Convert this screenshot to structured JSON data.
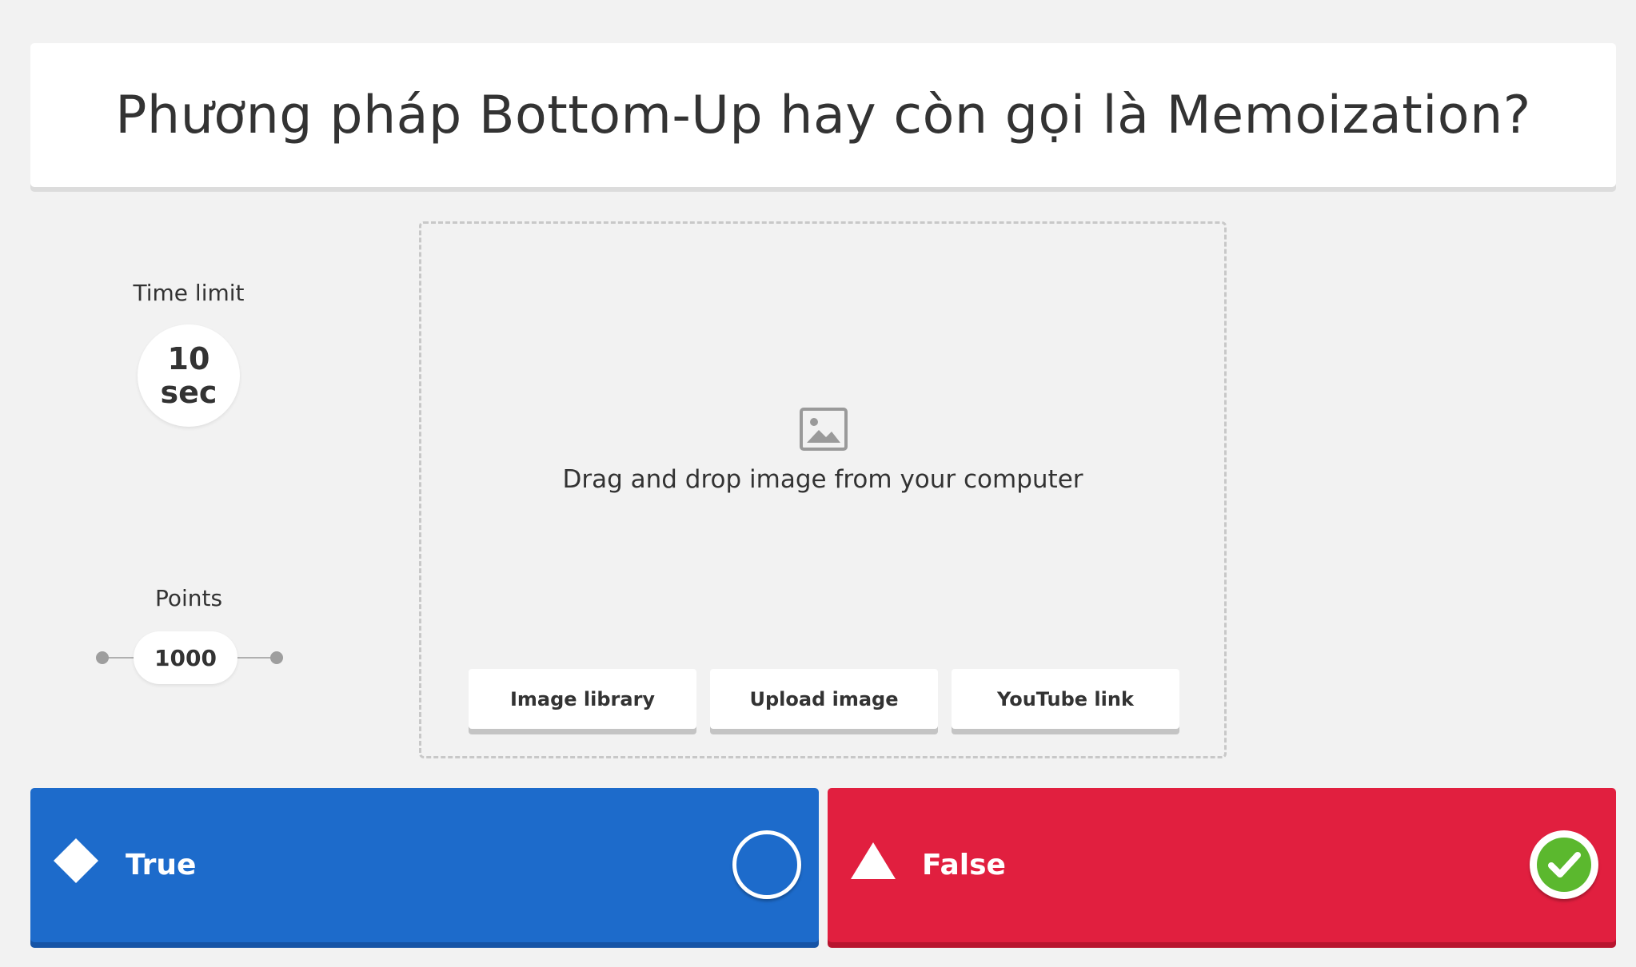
{
  "question": {
    "text": "Phương pháp Bottom-Up hay còn gọi là Memoization?"
  },
  "settings": {
    "time_limit_label": "Time limit",
    "time_value": "10",
    "time_unit": "sec",
    "points_label": "Points",
    "points_value": "1000"
  },
  "media": {
    "icon": "image-icon",
    "drop_text": "Drag and drop image from your computer",
    "buttons": [
      {
        "label": "Image library"
      },
      {
        "label": "Upload image"
      },
      {
        "label": "YouTube link"
      }
    ]
  },
  "answers": [
    {
      "label": "True",
      "shape": "diamond-icon",
      "color": "#1d6bcb",
      "correct": false
    },
    {
      "label": "False",
      "shape": "triangle-icon",
      "color": "#e11f3f",
      "correct": true
    }
  ],
  "colors": {
    "check_green": "#5bb82e",
    "background": "#f2f2f2"
  }
}
